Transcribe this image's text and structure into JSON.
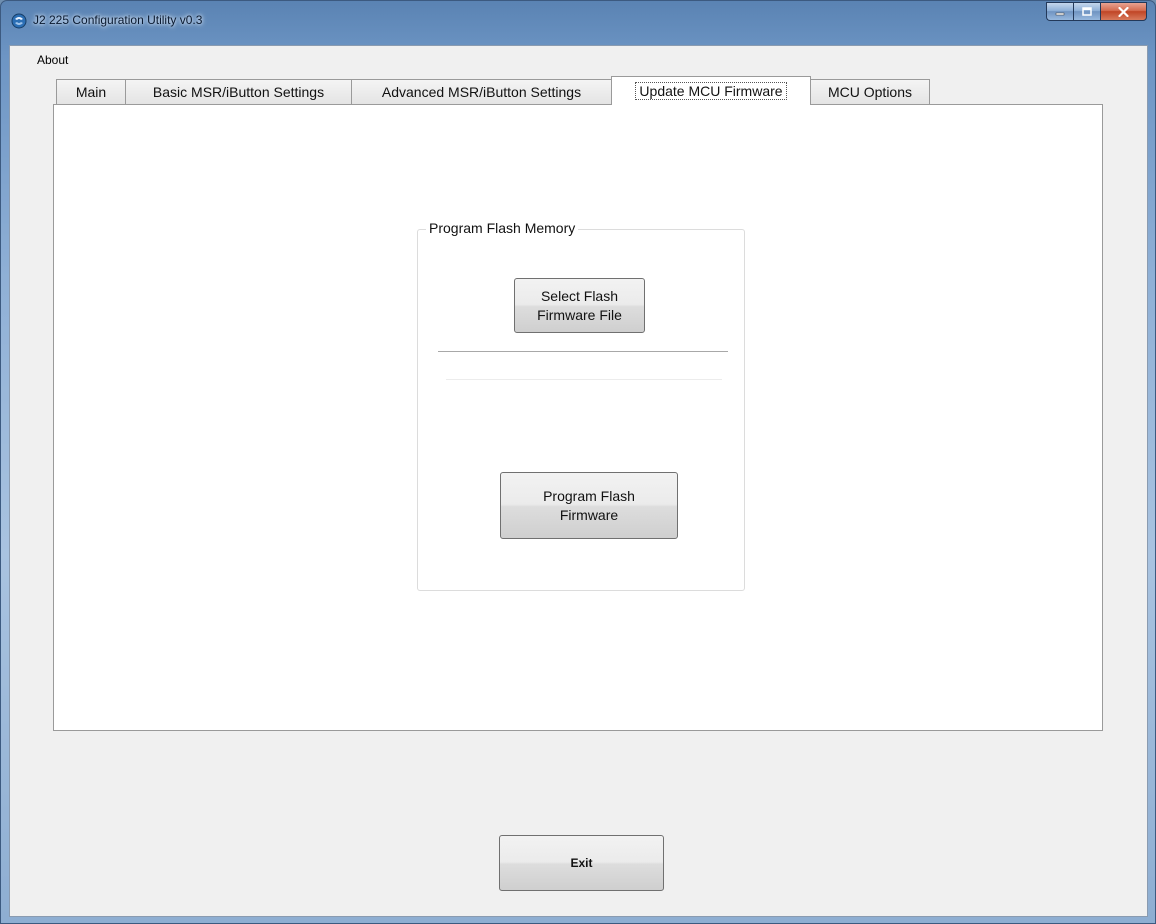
{
  "window": {
    "title": "J2 225 Configuration Utility  v0.3"
  },
  "menu": {
    "items": [
      "About"
    ]
  },
  "tabs": [
    {
      "label": "Main",
      "active": false
    },
    {
      "label": "Basic MSR/iButton Settings",
      "active": false
    },
    {
      "label": "Advanced MSR/iButton Settings",
      "active": false
    },
    {
      "label": "Update MCU Firmware",
      "active": true
    },
    {
      "label": "MCU Options",
      "active": false
    }
  ],
  "firmware_panel": {
    "group_title": "Program Flash Memory",
    "select_button": [
      "Select Flash",
      "Firmware File"
    ],
    "program_button": [
      "Program Flash",
      "Firmware"
    ]
  },
  "footer": {
    "exit_label": "Exit"
  },
  "icons": {
    "app": "app-icon",
    "minimize": "minimize-icon",
    "maximize": "maximize-icon",
    "close": "close-icon"
  },
  "colors": {
    "close_button": "#c84a2c",
    "title_bar": "#6d95c4"
  }
}
